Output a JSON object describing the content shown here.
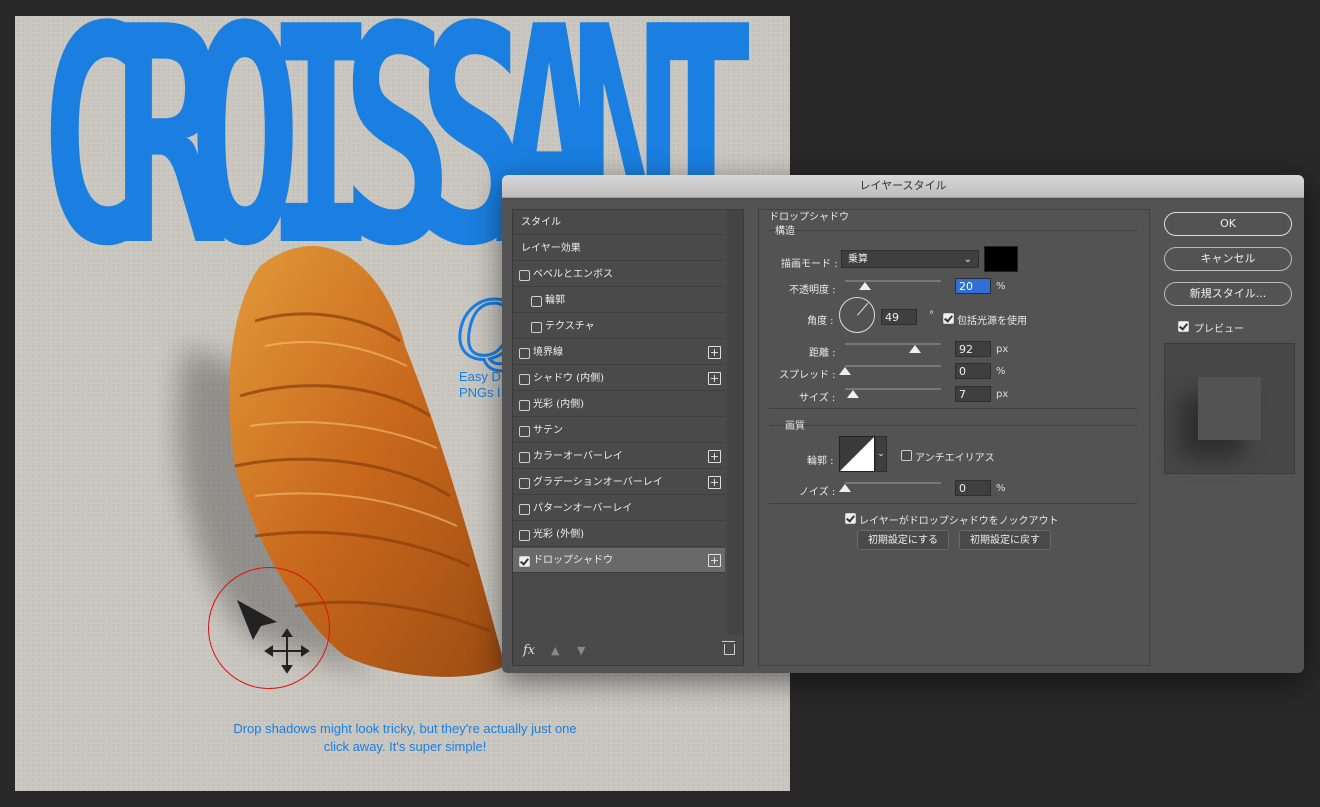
{
  "artboard": {
    "title": "CROISSANT",
    "side_text": "Easy D\nPNGs l",
    "caption": "Drop shadows might look tricky, but they're actually just one click away. It's super simple!"
  },
  "dialog": {
    "title": "レイヤースタイル",
    "styles": [
      {
        "label": "スタイル",
        "check": null,
        "plus": false
      },
      {
        "label": "レイヤー効果",
        "check": null,
        "plus": false
      },
      {
        "label": "ベベルとエンボス",
        "check": false,
        "plus": false
      },
      {
        "label": "輪郭",
        "check": false,
        "plus": false,
        "indent": true
      },
      {
        "label": "テクスチャ",
        "check": false,
        "plus": false,
        "indent": true
      },
      {
        "label": "境界線",
        "check": false,
        "plus": true
      },
      {
        "label": "シャドウ (内側)",
        "check": false,
        "plus": true
      },
      {
        "label": "光彩 (内側)",
        "check": false,
        "plus": false
      },
      {
        "label": "サテン",
        "check": false,
        "plus": false
      },
      {
        "label": "カラーオーバーレイ",
        "check": false,
        "plus": true
      },
      {
        "label": "グラデーションオーバーレイ",
        "check": false,
        "plus": true
      },
      {
        "label": "パターンオーバーレイ",
        "check": false,
        "plus": false
      },
      {
        "label": "光彩 (外側)",
        "check": false,
        "plus": false
      },
      {
        "label": "ドロップシャドウ",
        "check": true,
        "plus": true,
        "selected": true
      }
    ],
    "fx_label": "fx",
    "drop_shadow": {
      "section_title": "ドロップシャドウ",
      "structure": {
        "title": "構造",
        "blend_mode_label": "描画モード :",
        "blend_mode_value": "乗算",
        "shadow_color": "#000000",
        "opacity_label": "不透明度 :",
        "opacity_value": "20",
        "opacity_unit": "%",
        "angle_label": "角度 :",
        "angle_value": "49",
        "angle_unit": "°",
        "global_light_label": "包括光源を使用",
        "global_light_checked": true,
        "distance_label": "距離 :",
        "distance_value": "92",
        "distance_unit": "px",
        "spread_label": "スプレッド :",
        "spread_value": "0",
        "spread_unit": "%",
        "size_label": "サイズ :",
        "size_value": "7",
        "size_unit": "px"
      },
      "quality": {
        "title": "画質",
        "contour_label": "輪郭 :",
        "antialias_label": "アンチエイリアス",
        "antialias_checked": false,
        "noise_label": "ノイズ :",
        "noise_value": "0",
        "noise_unit": "%"
      },
      "knockout_label": "レイヤーがドロップシャドウをノックアウト",
      "knockout_checked": true,
      "make_default_label": "初期設定にする",
      "reset_default_label": "初期設定に戻す"
    },
    "buttons": {
      "ok": "OK",
      "cancel": "キャンセル",
      "new_style": "新規スタイル...",
      "preview_label": "プレビュー",
      "preview_checked": true
    }
  }
}
